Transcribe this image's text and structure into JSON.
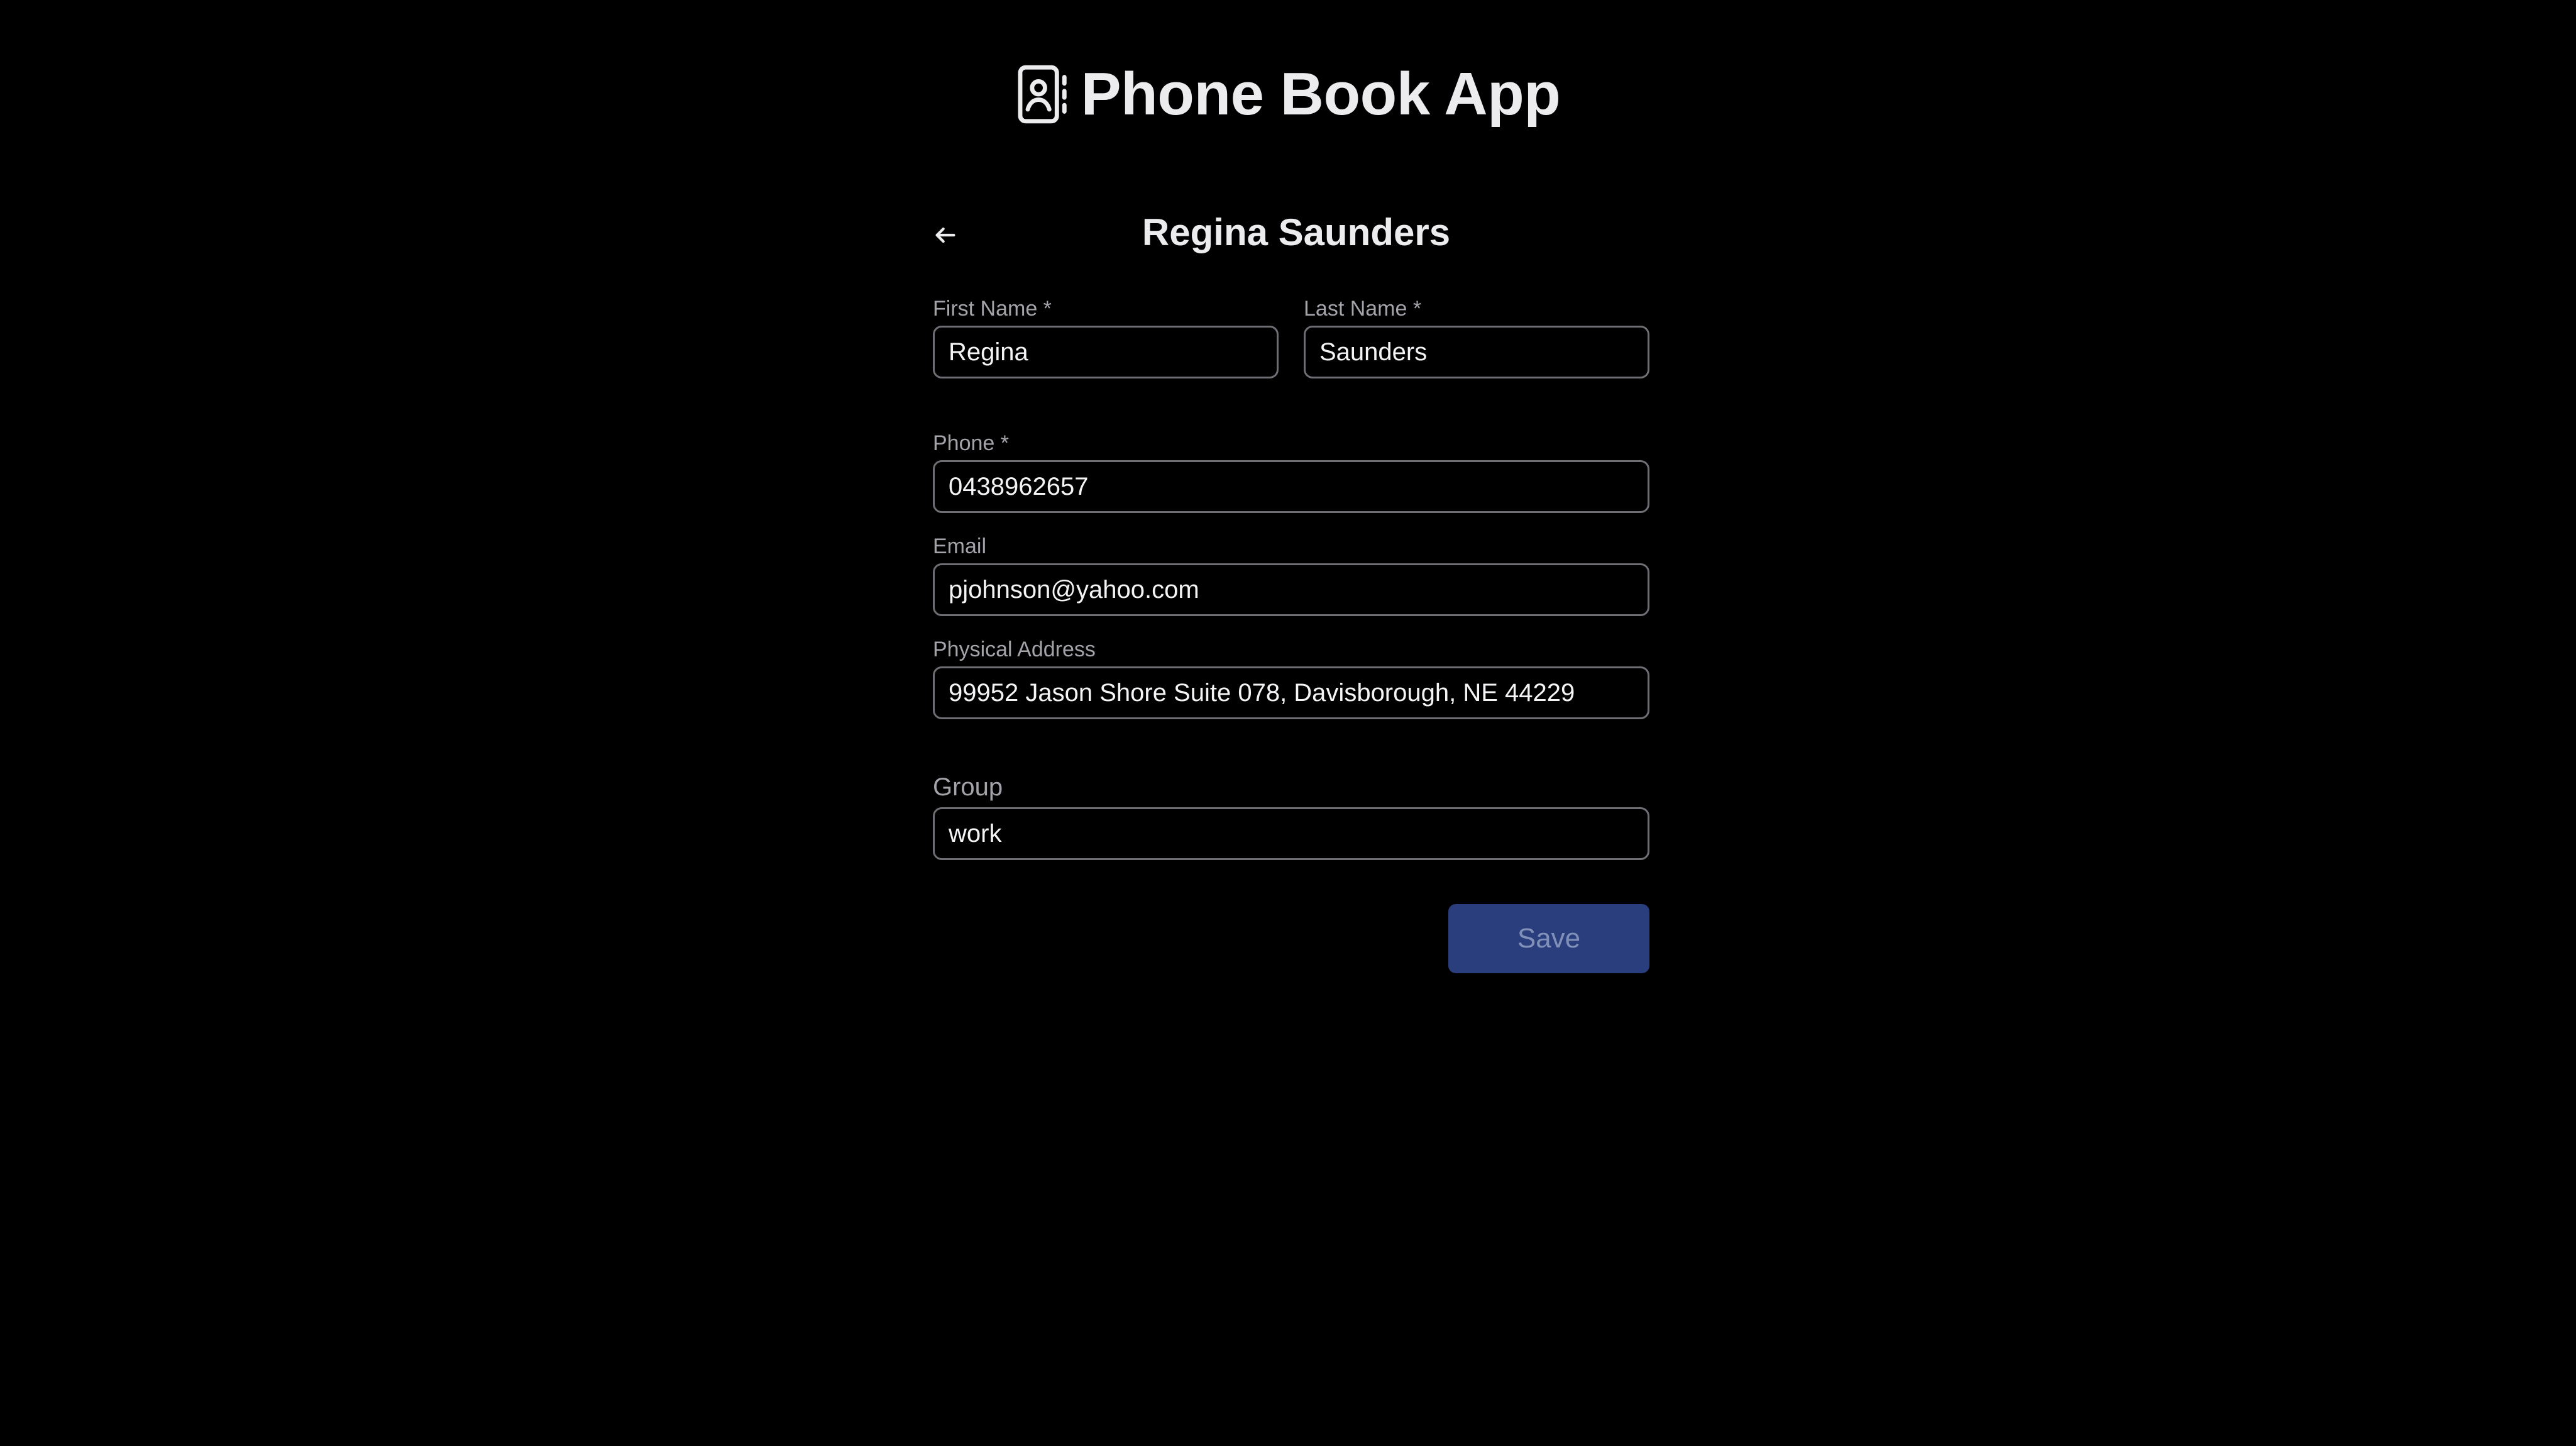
{
  "app": {
    "title": "Phone Book App",
    "logo_icon": "contact-book-icon"
  },
  "contact": {
    "title": "Regina Saunders",
    "back_icon": "arrow-left-icon"
  },
  "form": {
    "first_name": {
      "label": "First Name *",
      "value": "Regina"
    },
    "last_name": {
      "label": "Last Name *",
      "value": "Saunders"
    },
    "phone": {
      "label": "Phone *",
      "value": "0438962657"
    },
    "email": {
      "label": "Email",
      "value": "pjohnson@yahoo.com"
    },
    "address": {
      "label": "Physical Address",
      "value": "99952 Jason Shore Suite 078, Davisborough, NE 44229"
    },
    "group": {
      "label": "Group",
      "value": "work"
    },
    "save_label": "Save"
  },
  "colors": {
    "background": "#000000",
    "text": "#ececef",
    "label": "#a3a3aa",
    "input_border": "#6e6e74",
    "save_button_bg": "#2a3d7d",
    "save_button_text": "#8190b8"
  }
}
